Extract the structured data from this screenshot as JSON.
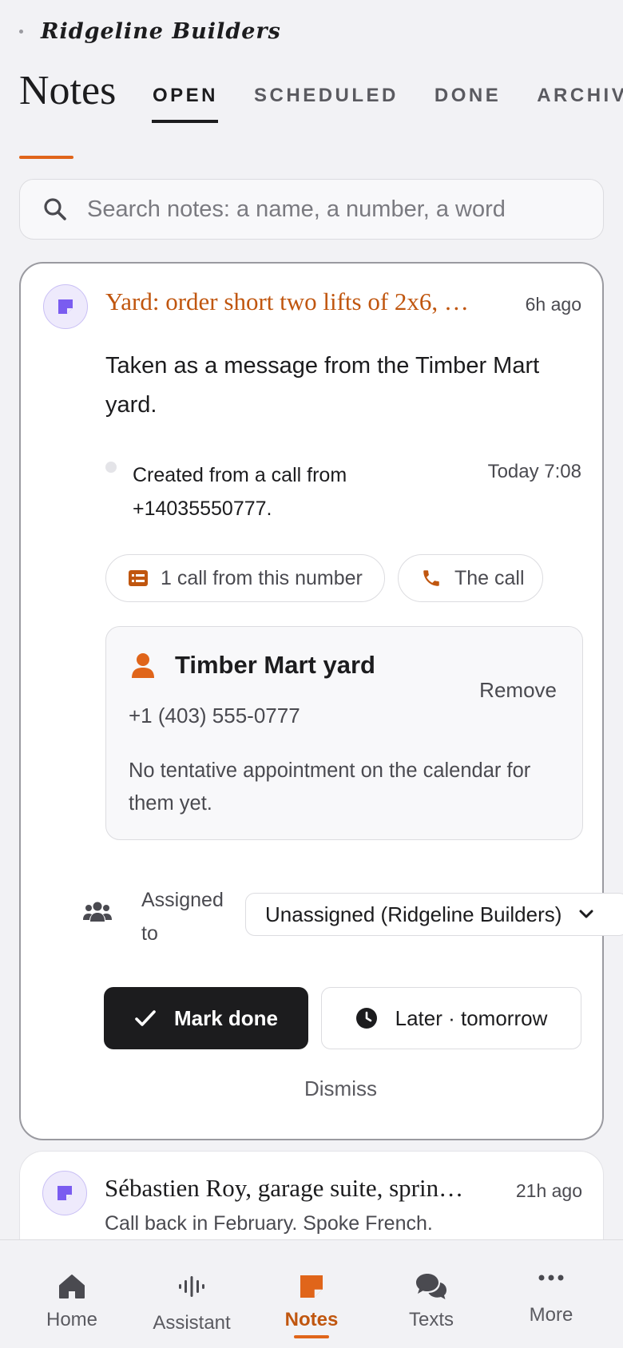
{
  "brand": {
    "name": "Ridgeline Builders"
  },
  "page": {
    "title": "Notes"
  },
  "tabs": [
    {
      "label": "OPEN",
      "active": true
    },
    {
      "label": "SCHEDULED",
      "active": false
    },
    {
      "label": "DONE",
      "active": false
    },
    {
      "label": "ARCHIV",
      "active": false
    }
  ],
  "search": {
    "placeholder": "Search notes: a name, a number, a word",
    "value": ""
  },
  "note1": {
    "headline": "Yard: order short two lifts of 2x6, …",
    "time": "6h ago",
    "body": "Taken as a message from the Timber Mart yard.",
    "activity": {
      "text": "Created from a call from +14035550777.",
      "time": "Today 7:08"
    },
    "chips": {
      "calls": "1 call from this number",
      "the_call": "The call"
    },
    "contact": {
      "name": "Timber Mart yard",
      "phone": "+1 (403) 555-0777",
      "remove_label": "Remove",
      "note": "No tentative appointment on the calendar for them yet."
    },
    "assigned": {
      "label": "Assigned to",
      "value": "Unassigned (Ridgeline Builders)"
    },
    "actions": {
      "done": "Mark done",
      "later": "Later · tomorrow",
      "dismiss": "Dismiss"
    }
  },
  "note2": {
    "headline": "Sébastien Roy, garage suite, sprin…",
    "time": "21h ago",
    "sub": "Call back in February. Spoke French."
  },
  "nav": {
    "home": "Home",
    "assistant": "Assistant",
    "notes": "Notes",
    "texts": "Texts",
    "more": "More"
  },
  "colors": {
    "accent": "#e0651a",
    "accent_text": "#c0560f",
    "note_icon": "#7a5cf0",
    "dark": "#1c1c1e"
  },
  "icons": [
    "search-icon",
    "note-icon",
    "list-icon",
    "phone-icon",
    "person-icon",
    "group-icon",
    "chevron-down-icon",
    "checkmark-icon",
    "clock-icon",
    "home-icon",
    "assistant-icon",
    "notes-icon",
    "texts-icon",
    "more-icon"
  ]
}
